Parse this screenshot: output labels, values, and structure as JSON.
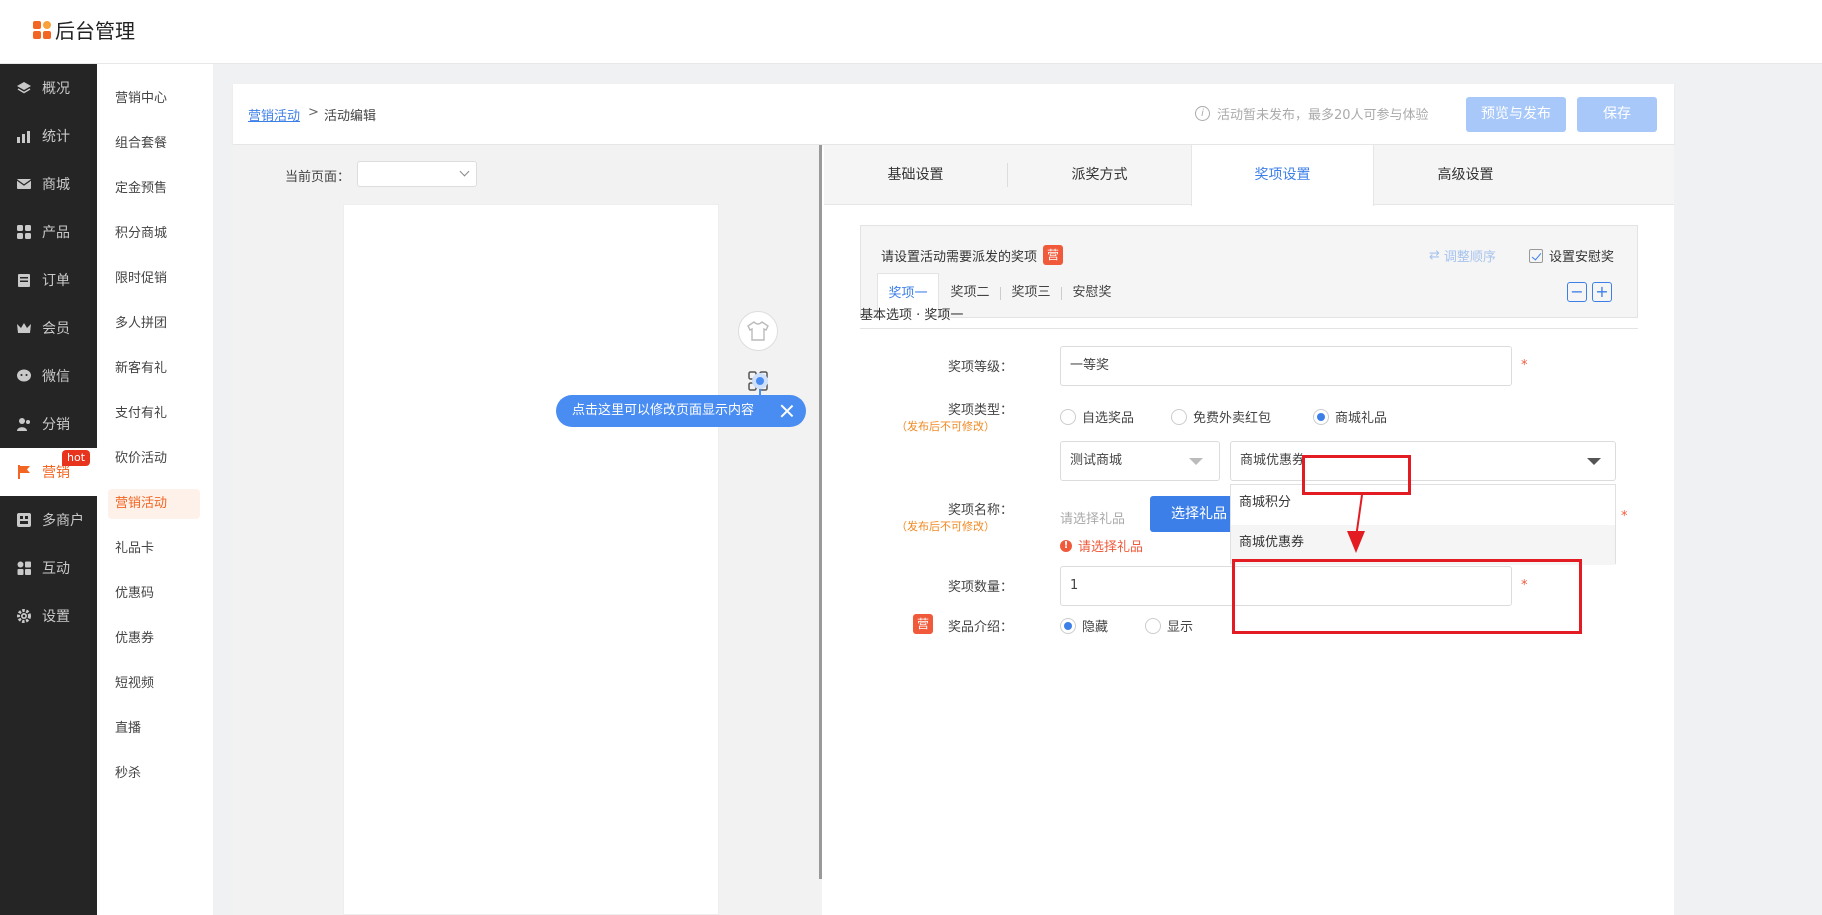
{
  "app": {
    "title": "后台管理"
  },
  "nav": {
    "items": [
      {
        "label": "概况",
        "icon": "layers-icon"
      },
      {
        "label": "统计",
        "icon": "chart-icon"
      },
      {
        "label": "商城",
        "icon": "mail-icon"
      },
      {
        "label": "产品",
        "icon": "apps-icon"
      },
      {
        "label": "订单",
        "icon": "order-icon"
      },
      {
        "label": "会员",
        "icon": "crown-icon"
      },
      {
        "label": "微信",
        "icon": "wechat-icon"
      },
      {
        "label": "分销",
        "icon": "users-icon"
      },
      {
        "label": "营销",
        "icon": "flag-icon",
        "badge": "hot"
      },
      {
        "label": "多商户",
        "icon": "store-icon"
      },
      {
        "label": "互动",
        "icon": "grid-icon"
      },
      {
        "label": "设置",
        "icon": "gear-icon"
      }
    ]
  },
  "subnav": {
    "items": [
      "营销中心",
      "组合套餐",
      "定金预售",
      "积分商城",
      "限时促销",
      "多人拼团",
      "新客有礼",
      "支付有礼",
      "砍价活动",
      "营销活动",
      "礼品卡",
      "优惠码",
      "优惠券",
      "短视频",
      "直播",
      "秒杀"
    ],
    "active": "营销活动"
  },
  "breadcrumb": {
    "link": "营销活动",
    "sep": ">",
    "current": "活动编辑"
  },
  "header": {
    "notice": "活动暂未发布，最多20人可参与体验",
    "preview_button": "预览与发布",
    "save_button": "保存"
  },
  "preview": {
    "current_page_label": "当前页面：",
    "current_page_value": "",
    "tip": "点击这里可以修改页面显示内容"
  },
  "tabs": [
    "基础设置",
    "派奖方式",
    "奖项设置",
    "高级设置"
  ],
  "active_tab": "奖项设置",
  "prize_box": {
    "title": "请设置活动需要派发的奖项",
    "badge": "营",
    "reorder": "调整顺序",
    "comfort_label": "设置安慰奖",
    "comfort_checked": true,
    "tabs": [
      "奖项一",
      "奖项二",
      "奖项三",
      "安慰奖"
    ],
    "minus": "−",
    "plus": "+"
  },
  "section": {
    "title": "基本选项 · 奖项一"
  },
  "form": {
    "level_label": "奖项等级：",
    "level_value": "一等奖",
    "type_label": "奖项类型：",
    "type_note": "（发布后不可修改）",
    "type_options": [
      "自选奖品",
      "免费外卖红包",
      "商城礼品"
    ],
    "type_selected": "商城礼品",
    "shop_select": "测试商城",
    "gift_type_select": "商城优惠券",
    "name_label": "奖项名称：",
    "name_note": "（发布后不可修改）",
    "name_placeholder": "请选择礼品",
    "choose_button": "选择礼品",
    "name_error": "请选择礼品",
    "dropdown_options": [
      "商城积分",
      "商城优惠券"
    ],
    "qty_label": "奖项数量：",
    "qty_value": "1",
    "intro_badge": "营",
    "intro_label": "奖品介绍：",
    "intro_options": [
      "隐藏",
      "显示"
    ],
    "intro_selected": "隐藏",
    "required": "*"
  },
  "colors": {
    "accent": "#3d7fe8",
    "brand": "#f26522",
    "highlight": "#e31c23",
    "sidebar": "#252525"
  }
}
